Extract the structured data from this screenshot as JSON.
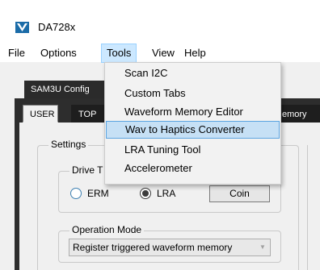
{
  "window": {
    "title": "DA728x"
  },
  "menubar": {
    "items": [
      {
        "label": "File"
      },
      {
        "label": "Options"
      },
      {
        "label": "Tools"
      },
      {
        "label": "View"
      },
      {
        "label": "Help"
      }
    ]
  },
  "tools_menu": {
    "items": [
      {
        "label": "Scan I2C"
      },
      {
        "label": "Custom Tabs"
      },
      {
        "label": "Waveform Memory Editor"
      },
      {
        "label": "Wav to Haptics Converter"
      },
      {
        "label": "LRA Tuning Tool"
      },
      {
        "label": "Accelerometer"
      }
    ],
    "highlighted_index": 3
  },
  "top_tabs": [
    {
      "label": "SAM3U Config"
    }
  ],
  "sub_tabs": [
    {
      "label": "USER"
    },
    {
      "label": "TOP"
    },
    {
      "label": "emory"
    }
  ],
  "settings": {
    "label": "Settings",
    "drive_group": {
      "label": "Drive T",
      "options": [
        {
          "label": "ERM",
          "selected": false
        },
        {
          "label": "LRA",
          "selected": true
        }
      ],
      "coin_button": "Coin"
    },
    "operation_mode": {
      "label": "Operation Mode",
      "value": "Register triggered waveform memory"
    }
  },
  "colors": {
    "menu_highlight": "#c6e0f5",
    "menu_open": "#cce8ff",
    "dark_tab": "#1e1e1e",
    "radio_accent": "#3c7fb1"
  }
}
